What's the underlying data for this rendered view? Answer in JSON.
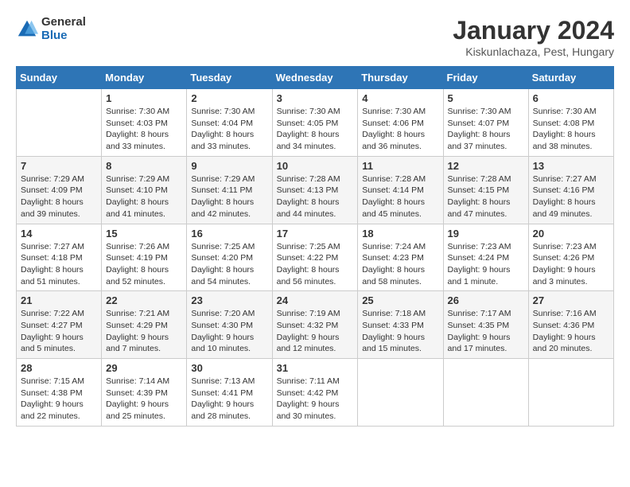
{
  "header": {
    "logo_general": "General",
    "logo_blue": "Blue",
    "month_title": "January 2024",
    "subtitle": "Kiskunlachaza, Pest, Hungary"
  },
  "weekdays": [
    "Sunday",
    "Monday",
    "Tuesday",
    "Wednesday",
    "Thursday",
    "Friday",
    "Saturday"
  ],
  "weeks": [
    [
      {
        "day": "",
        "info": ""
      },
      {
        "day": "1",
        "info": "Sunrise: 7:30 AM\nSunset: 4:03 PM\nDaylight: 8 hours\nand 33 minutes."
      },
      {
        "day": "2",
        "info": "Sunrise: 7:30 AM\nSunset: 4:04 PM\nDaylight: 8 hours\nand 33 minutes."
      },
      {
        "day": "3",
        "info": "Sunrise: 7:30 AM\nSunset: 4:05 PM\nDaylight: 8 hours\nand 34 minutes."
      },
      {
        "day": "4",
        "info": "Sunrise: 7:30 AM\nSunset: 4:06 PM\nDaylight: 8 hours\nand 36 minutes."
      },
      {
        "day": "5",
        "info": "Sunrise: 7:30 AM\nSunset: 4:07 PM\nDaylight: 8 hours\nand 37 minutes."
      },
      {
        "day": "6",
        "info": "Sunrise: 7:30 AM\nSunset: 4:08 PM\nDaylight: 8 hours\nand 38 minutes."
      }
    ],
    [
      {
        "day": "7",
        "info": "Sunrise: 7:29 AM\nSunset: 4:09 PM\nDaylight: 8 hours\nand 39 minutes."
      },
      {
        "day": "8",
        "info": "Sunrise: 7:29 AM\nSunset: 4:10 PM\nDaylight: 8 hours\nand 41 minutes."
      },
      {
        "day": "9",
        "info": "Sunrise: 7:29 AM\nSunset: 4:11 PM\nDaylight: 8 hours\nand 42 minutes."
      },
      {
        "day": "10",
        "info": "Sunrise: 7:28 AM\nSunset: 4:13 PM\nDaylight: 8 hours\nand 44 minutes."
      },
      {
        "day": "11",
        "info": "Sunrise: 7:28 AM\nSunset: 4:14 PM\nDaylight: 8 hours\nand 45 minutes."
      },
      {
        "day": "12",
        "info": "Sunrise: 7:28 AM\nSunset: 4:15 PM\nDaylight: 8 hours\nand 47 minutes."
      },
      {
        "day": "13",
        "info": "Sunrise: 7:27 AM\nSunset: 4:16 PM\nDaylight: 8 hours\nand 49 minutes."
      }
    ],
    [
      {
        "day": "14",
        "info": "Sunrise: 7:27 AM\nSunset: 4:18 PM\nDaylight: 8 hours\nand 51 minutes."
      },
      {
        "day": "15",
        "info": "Sunrise: 7:26 AM\nSunset: 4:19 PM\nDaylight: 8 hours\nand 52 minutes."
      },
      {
        "day": "16",
        "info": "Sunrise: 7:25 AM\nSunset: 4:20 PM\nDaylight: 8 hours\nand 54 minutes."
      },
      {
        "day": "17",
        "info": "Sunrise: 7:25 AM\nSunset: 4:22 PM\nDaylight: 8 hours\nand 56 minutes."
      },
      {
        "day": "18",
        "info": "Sunrise: 7:24 AM\nSunset: 4:23 PM\nDaylight: 8 hours\nand 58 minutes."
      },
      {
        "day": "19",
        "info": "Sunrise: 7:23 AM\nSunset: 4:24 PM\nDaylight: 9 hours\nand 1 minute."
      },
      {
        "day": "20",
        "info": "Sunrise: 7:23 AM\nSunset: 4:26 PM\nDaylight: 9 hours\nand 3 minutes."
      }
    ],
    [
      {
        "day": "21",
        "info": "Sunrise: 7:22 AM\nSunset: 4:27 PM\nDaylight: 9 hours\nand 5 minutes."
      },
      {
        "day": "22",
        "info": "Sunrise: 7:21 AM\nSunset: 4:29 PM\nDaylight: 9 hours\nand 7 minutes."
      },
      {
        "day": "23",
        "info": "Sunrise: 7:20 AM\nSunset: 4:30 PM\nDaylight: 9 hours\nand 10 minutes."
      },
      {
        "day": "24",
        "info": "Sunrise: 7:19 AM\nSunset: 4:32 PM\nDaylight: 9 hours\nand 12 minutes."
      },
      {
        "day": "25",
        "info": "Sunrise: 7:18 AM\nSunset: 4:33 PM\nDaylight: 9 hours\nand 15 minutes."
      },
      {
        "day": "26",
        "info": "Sunrise: 7:17 AM\nSunset: 4:35 PM\nDaylight: 9 hours\nand 17 minutes."
      },
      {
        "day": "27",
        "info": "Sunrise: 7:16 AM\nSunset: 4:36 PM\nDaylight: 9 hours\nand 20 minutes."
      }
    ],
    [
      {
        "day": "28",
        "info": "Sunrise: 7:15 AM\nSunset: 4:38 PM\nDaylight: 9 hours\nand 22 minutes."
      },
      {
        "day": "29",
        "info": "Sunrise: 7:14 AM\nSunset: 4:39 PM\nDaylight: 9 hours\nand 25 minutes."
      },
      {
        "day": "30",
        "info": "Sunrise: 7:13 AM\nSunset: 4:41 PM\nDaylight: 9 hours\nand 28 minutes."
      },
      {
        "day": "31",
        "info": "Sunrise: 7:11 AM\nSunset: 4:42 PM\nDaylight: 9 hours\nand 30 minutes."
      },
      {
        "day": "",
        "info": ""
      },
      {
        "day": "",
        "info": ""
      },
      {
        "day": "",
        "info": ""
      }
    ]
  ]
}
